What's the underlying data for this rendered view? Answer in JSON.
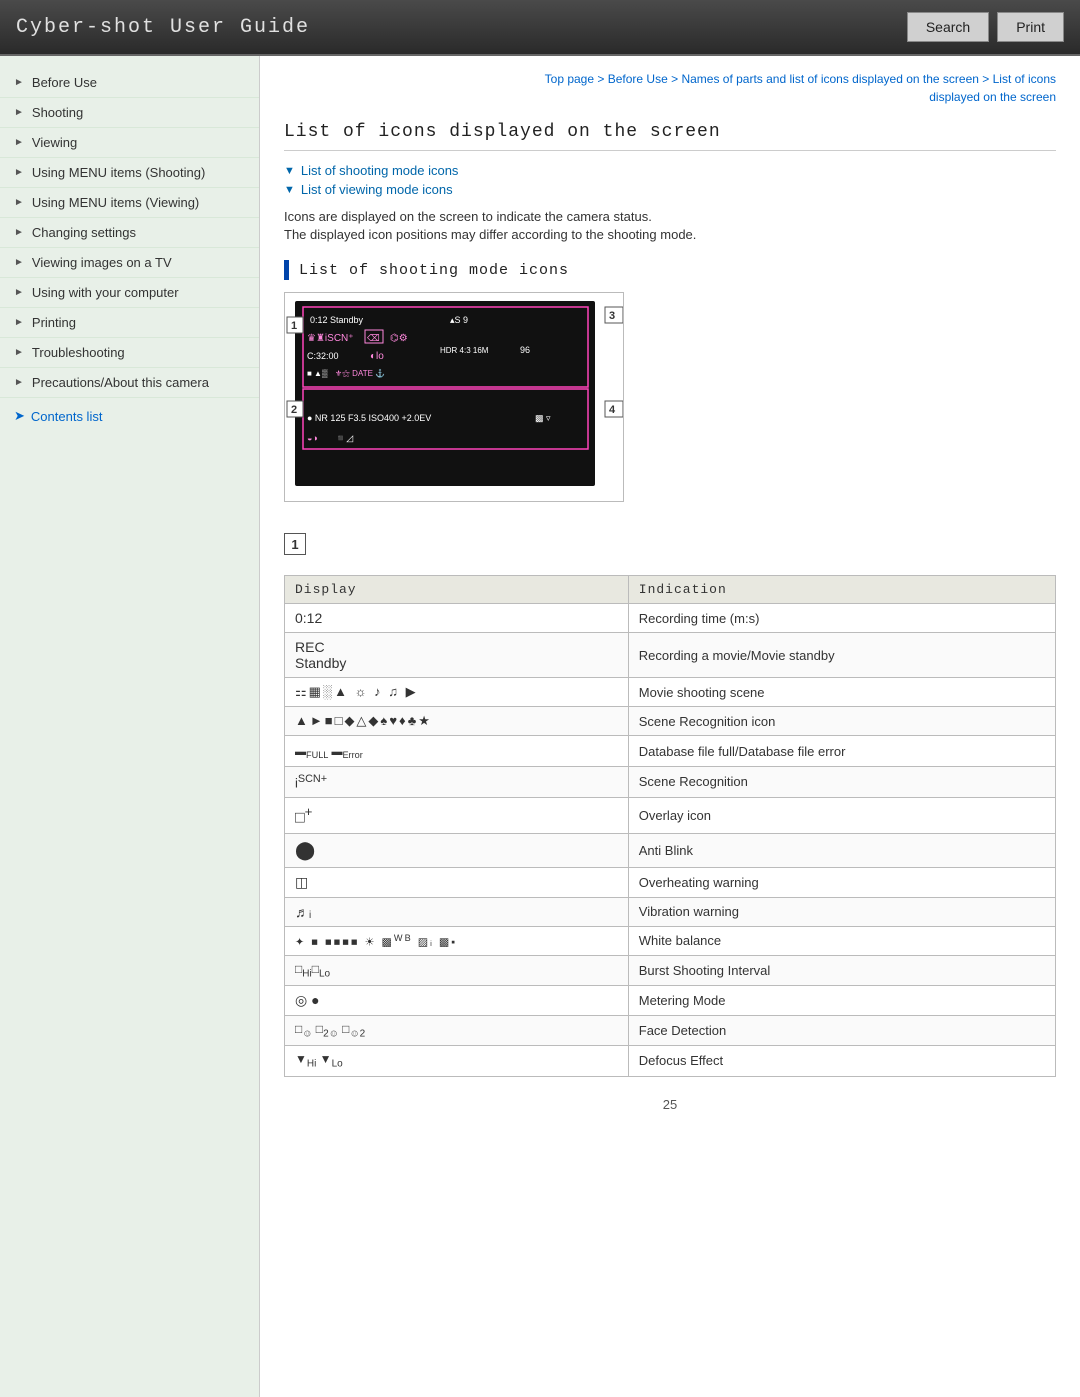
{
  "header": {
    "title": "Cyber-shot User Guide",
    "search_label": "Search",
    "print_label": "Print"
  },
  "breadcrumb": {
    "parts": [
      "Top page",
      "Before Use",
      "Names of parts and list of icons displayed on the screen",
      "List of icons displayed on the screen"
    ],
    "separator": " > "
  },
  "sidebar": {
    "items": [
      {
        "label": "Before Use",
        "active": true
      },
      {
        "label": "Shooting"
      },
      {
        "label": "Viewing"
      },
      {
        "label": "Using MENU items (Shooting)"
      },
      {
        "label": "Using MENU items (Viewing)"
      },
      {
        "label": "Changing settings"
      },
      {
        "label": "Viewing images on a TV"
      },
      {
        "label": "Using with your computer"
      },
      {
        "label": "Printing"
      },
      {
        "label": "Troubleshooting"
      },
      {
        "label": "Precautions/About this camera"
      }
    ],
    "contents_link": "Contents list"
  },
  "page": {
    "title": "List of icons displayed on the screen",
    "links": [
      "List of shooting mode icons",
      "List of viewing mode icons"
    ],
    "desc_lines": [
      "Icons are displayed on the screen to indicate the camera status.",
      "The displayed icon positions may differ according to the shooting mode."
    ],
    "section1_title": "List of shooting mode icons",
    "section1_num": "1",
    "table": {
      "col1": "Display",
      "col2": "Indication",
      "rows": [
        {
          "display": "0:12",
          "indication": "Recording time (m:s)"
        },
        {
          "display": "REC\nStandby",
          "indication": "Recording a movie/Movie standby"
        },
        {
          "display": "ICONS_MOVIE",
          "indication": "Movie shooting scene"
        },
        {
          "display": "ICONS_SCENE",
          "indication": "Scene Recognition icon"
        },
        {
          "display": "ICONS_DB",
          "indication": "Database file full/Database file error"
        },
        {
          "display": "ICON_SCN",
          "indication": "Scene Recognition"
        },
        {
          "display": "ICON_OVERLAY",
          "indication": "Overlay icon"
        },
        {
          "display": "ICON_ANTIBLINK",
          "indication": "Anti Blink"
        },
        {
          "display": "ICON_OVERHEAT",
          "indication": "Overheating warning"
        },
        {
          "display": "ICON_VIBRATION",
          "indication": "Vibration warning"
        },
        {
          "display": "ICONS_WB",
          "indication": "White balance"
        },
        {
          "display": "ICONS_BURST",
          "indication": "Burst Shooting Interval"
        },
        {
          "display": "ICONS_METER",
          "indication": "Metering Mode"
        },
        {
          "display": "ICONS_FACE",
          "indication": "Face Detection"
        },
        {
          "display": "ICONS_DEFOCUS",
          "indication": "Defocus Effect"
        }
      ]
    },
    "page_number": "25"
  }
}
